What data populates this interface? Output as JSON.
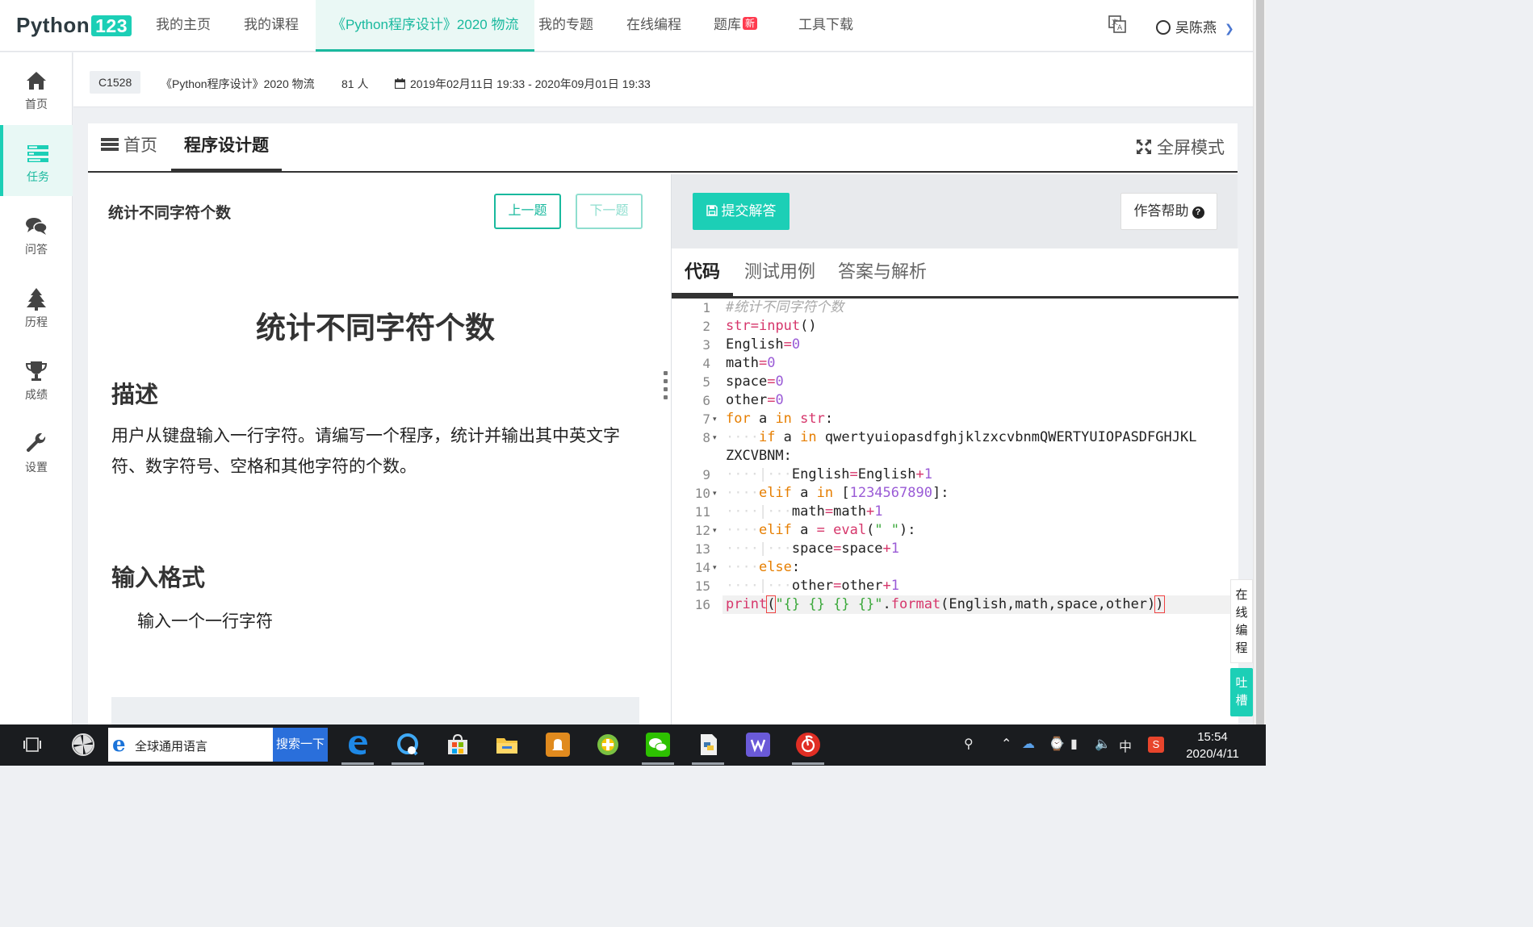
{
  "nav": {
    "logo_text": "Python",
    "logo_badge": "123",
    "items": [
      {
        "label": "我的主页"
      },
      {
        "label": "我的课程"
      },
      {
        "label": "《Python程序设计》2020 物流"
      },
      {
        "label": "我的专题"
      },
      {
        "label": "在线编程"
      },
      {
        "label": "题库"
      },
      {
        "label": "工具下载"
      }
    ],
    "new_badge": "新",
    "user_name": "吴陈燕"
  },
  "sidebar": {
    "items": [
      {
        "label": "首页",
        "icon": "home-icon"
      },
      {
        "label": "任务",
        "icon": "tasks-icon"
      },
      {
        "label": "问答",
        "icon": "comments-icon"
      },
      {
        "label": "历程",
        "icon": "tree-icon"
      },
      {
        "label": "成绩",
        "icon": "trophy-icon"
      },
      {
        "label": "设置",
        "icon": "wrench-icon"
      }
    ],
    "active": "任务"
  },
  "course": {
    "code": "C1528",
    "name": "《Python程序设计》2020 物流",
    "members": "81 人",
    "period": "2019年02月11日 19:33 - 2020年09月01日 19:33"
  },
  "tabs": {
    "home": "首页",
    "programming": "程序设计题",
    "fullscreen": "全屏模式"
  },
  "question": {
    "title_small": "统计不同字符个数",
    "prev": "上一题",
    "next": "下一题",
    "title_big": "统计不同字符个数",
    "desc_heading": "描述",
    "desc": "用户从键盘输入一行字符。请编写一个程序，统计并输出其中英文字符、数字符号、空格和其他字符的个数。",
    "input_heading": "输入格式",
    "input_text": "输入一个一行字符"
  },
  "editor_panel": {
    "submit": "提交解答",
    "help": "作答帮助",
    "tabs": [
      "代码",
      "测试用例",
      "答案与解析"
    ]
  },
  "code_lines": [
    "#统计不同字符个数",
    "str=input()",
    "English=0",
    "math=0",
    "space=0",
    "other=0",
    "for a in str:",
    "    if a in qwertyuiopasdfghjklzxcvbnmQWERTYUIOPASDFGHJKL",
    "ZXCVBNM:",
    "        English=English+1",
    "    elif a in [1234567890]:",
    "        math=math+1",
    "    elif a = eval(\" \"):",
    "        space=space+1",
    "    else:",
    "        other=other+1",
    "print(\"{} {} {} {}\".format(English,math,space,other))"
  ],
  "floating": {
    "online": "在线编程",
    "tucao": "吐槽"
  },
  "taskbar": {
    "search_text": "全球通用语言",
    "search_button": "搜索一下",
    "ime": "中",
    "time": "15:54",
    "date": "2020/4/11"
  },
  "colors": {
    "accent": "#1ccfb6",
    "accent_dark": "#19b99e",
    "new_badge": "#ff3b4f"
  }
}
